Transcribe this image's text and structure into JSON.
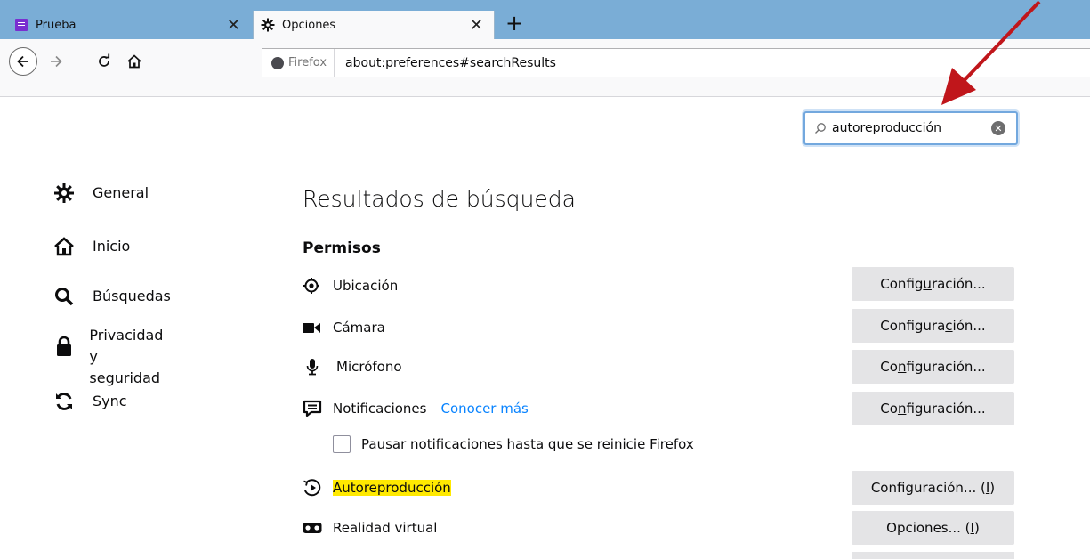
{
  "tabs": [
    {
      "title": "Prueba",
      "icon": "form-app-icon"
    },
    {
      "title": "Opciones",
      "icon": "gear-icon"
    }
  ],
  "nav": {
    "identity_label": "Firefox",
    "url": "about:preferences#searchResults"
  },
  "search": {
    "value": "autoreproducción"
  },
  "sidebar": {
    "items": [
      {
        "label": "General",
        "icon": "gear-icon"
      },
      {
        "label": "Inicio",
        "icon": "home-icon"
      },
      {
        "label": "Búsquedas",
        "icon": "search-icon"
      },
      {
        "label_line1": "Privacidad y",
        "label_line2": "seguridad",
        "icon": "lock-icon"
      },
      {
        "label": "Sync",
        "icon": "sync-icon"
      }
    ]
  },
  "results": {
    "title": "Resultados de búsqueda",
    "section": "Permisos",
    "rows": [
      {
        "label": "Ubicación",
        "icon": "location-icon",
        "button_pre": "Config",
        "button_ul": "u",
        "button_post": "ración..."
      },
      {
        "label": "Cámara",
        "icon": "camera-icon",
        "button_pre": "Configura",
        "button_ul": "c",
        "button_post": "ión..."
      },
      {
        "label": "Micrófono",
        "icon": "microphone-icon",
        "button_pre": "Co",
        "button_ul": "n",
        "button_post": "figuración..."
      },
      {
        "label": "Notificaciones",
        "icon": "notification-icon",
        "link": "Conocer más",
        "button_pre": "Co",
        "button_ul": "n",
        "button_post": "figuración..."
      },
      {
        "label": "Autoreproducción",
        "icon": "autoplay-icon",
        "button_pre": "Configuración... (",
        "button_ul": "I",
        "button_post": ")"
      },
      {
        "label": "Realidad virtual",
        "icon": "vr-icon",
        "button_pre": "Opciones... (",
        "button_ul": "I",
        "button_post": ")"
      }
    ],
    "checkbox": {
      "pre": "Pausar ",
      "ul": "n",
      "post": "otificaciones hasta que se reinicie Firefox"
    }
  },
  "colors": {
    "tabstrip": "#7aadd6",
    "highlight": "#ffe900",
    "link": "#0a84ff",
    "annotation_arrow": "#c0161b"
  }
}
